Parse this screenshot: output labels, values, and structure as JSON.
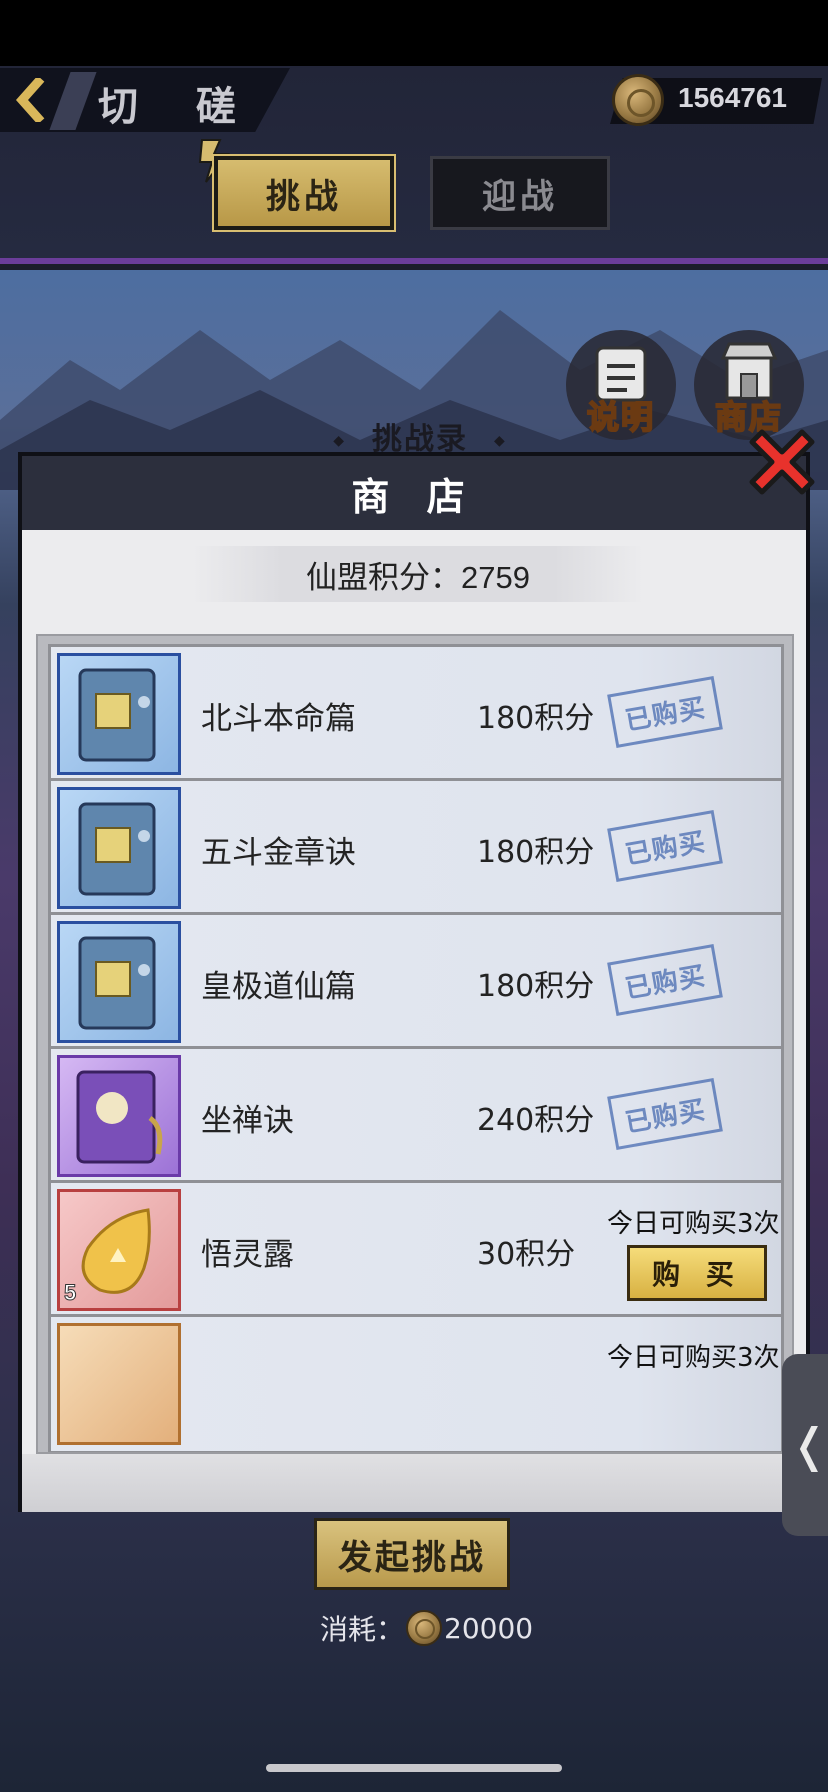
{
  "header": {
    "title": "切 磋台",
    "currency": "1564761",
    "tabs": [
      {
        "label": "挑战",
        "active": true
      },
      {
        "label": "迎战",
        "active": false
      }
    ]
  },
  "scene": {
    "info_button_label": "说明",
    "shop_button_label": "商店",
    "record_title": "挑战录"
  },
  "shop": {
    "title": "商 店",
    "points_label": "仙盟积分：2759",
    "items": [
      {
        "name": "北斗本命篇",
        "price": "180积分",
        "status": "已购买",
        "icon": "blue-manual-icon"
      },
      {
        "name": "五斗金章诀",
        "price": "180积分",
        "status": "已购买",
        "icon": "blue-manual-icon"
      },
      {
        "name": "皇极道仙篇",
        "price": "180积分",
        "status": "已购买",
        "icon": "blue-manual-icon"
      },
      {
        "name": "坐禅诀",
        "price": "240积分",
        "status": "已购买",
        "icon": "purple-manual-icon"
      },
      {
        "name": "悟灵露",
        "price": "30积分",
        "limit": "今日可购买3次",
        "buy_label": "购 买",
        "count": "5",
        "icon": "golden-dew-drop-icon"
      },
      {
        "limit": "今日可购买3次",
        "icon": "orange-item-icon"
      }
    ]
  },
  "footer": {
    "launch_label": "发起挑战",
    "cost_label": "消耗：",
    "cost_value": "20000"
  },
  "colors": {
    "accent_gold": "#d6bc6f",
    "stamp_blue": "#5a7ab8",
    "purple_divider": "#6b3d9a"
  }
}
